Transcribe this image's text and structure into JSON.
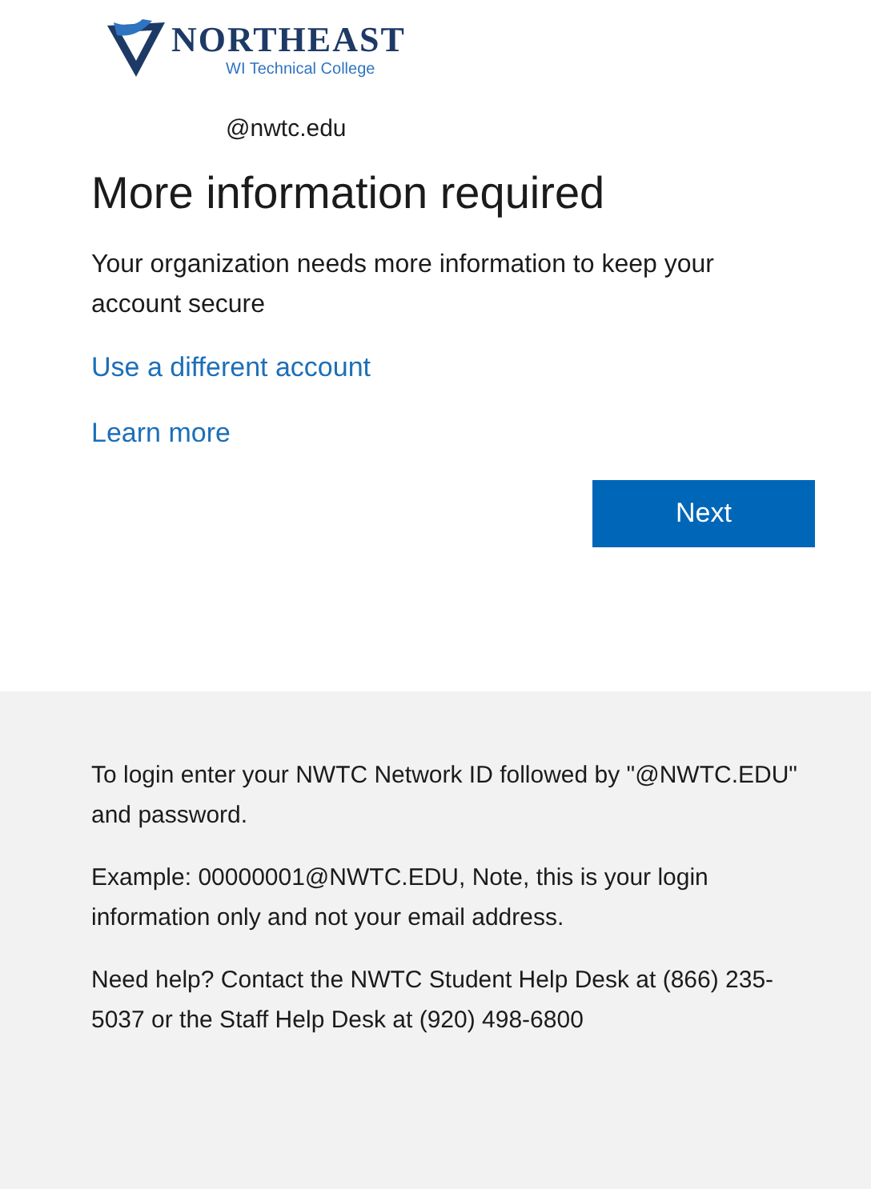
{
  "logo": {
    "name": "NORTHEAST",
    "subtitle": "WI Technical College"
  },
  "account": "@nwtc.edu",
  "title": "More information required",
  "message": "Your organization needs more information to keep your account secure",
  "links": [
    "Use a different account",
    "Learn more"
  ],
  "button": "Next",
  "footer": [
    "To login enter your NWTC Network ID followed by \"@NWTC.EDU\" and password.",
    "Example: 00000001@NWTC.EDU, Note, this is your login information only and not your email address.",
    "Need help? Contact the NWTC Student Help Desk at (866) 235-5037 or the Staff Help Desk at (920) 498-6800"
  ]
}
